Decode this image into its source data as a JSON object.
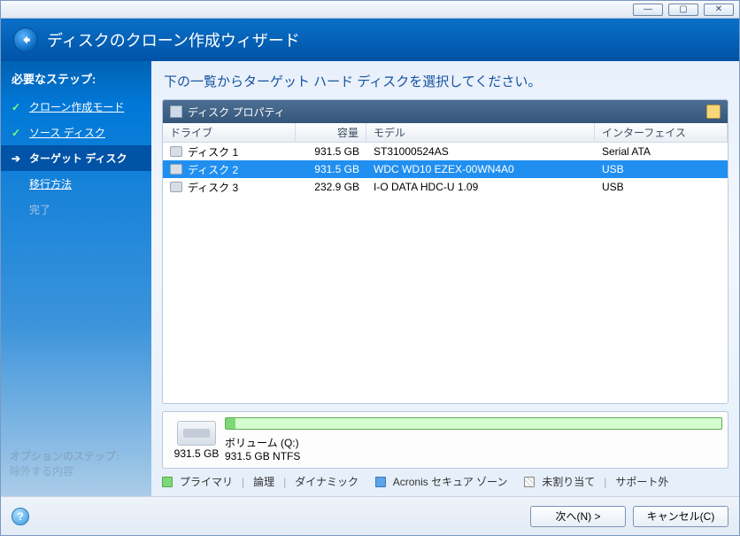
{
  "titlebar": {
    "min": "—",
    "max": "▢",
    "close": "✕"
  },
  "header": {
    "title": "ディスクのクローン作成ウィザード"
  },
  "sidebar": {
    "title": "必要なステップ:",
    "steps": [
      {
        "label": "クローン作成モード",
        "mark": "✓",
        "state": "done"
      },
      {
        "label": "ソース ディスク",
        "mark": "✓",
        "state": "done"
      },
      {
        "label": "ターゲット ディスク",
        "mark": "➔",
        "state": "current"
      },
      {
        "label": "移行方法",
        "mark": "",
        "state": "pending"
      },
      {
        "label": "完了",
        "mark": "",
        "state": "disabled"
      }
    ],
    "footer1": "オプションのステップ:",
    "footer2": "除外する内容"
  },
  "main": {
    "prompt": "下の一覧からターゲット ハード ディスクを選択してください。",
    "panel_title": "ディスク プロパティ",
    "columns": {
      "drive": "ドライブ",
      "capacity": "容量",
      "model": "モデル",
      "interface": "インターフェイス"
    },
    "rows": [
      {
        "drive": "ディスク 1",
        "capacity": "931.5 GB",
        "model": "ST31000524AS",
        "interface": "Serial ATA",
        "selected": false
      },
      {
        "drive": "ディスク 2",
        "capacity": "931.5 GB",
        "model": "WDC WD10 EZEX-00WN4A0",
        "interface": "USB",
        "selected": true
      },
      {
        "drive": "ディスク 3",
        "capacity": "232.9 GB",
        "model": "I-O DATA HDC-U 1.09",
        "interface": "USB",
        "selected": false
      }
    ],
    "partition": {
      "total": "931.5 GB",
      "vol_label": "ボリューム (Q:)",
      "vol_detail": "931.5 GB  NTFS"
    },
    "legend": {
      "primary": "プライマリ",
      "logical": "論理",
      "dynamic": "ダイナミック",
      "acronis": "Acronis セキュア ゾーン",
      "unalloc": "未割り当て",
      "unsupported": "サポート外"
    }
  },
  "footer": {
    "next": "次へ(N) >",
    "cancel": "キャンセル(C)"
  }
}
